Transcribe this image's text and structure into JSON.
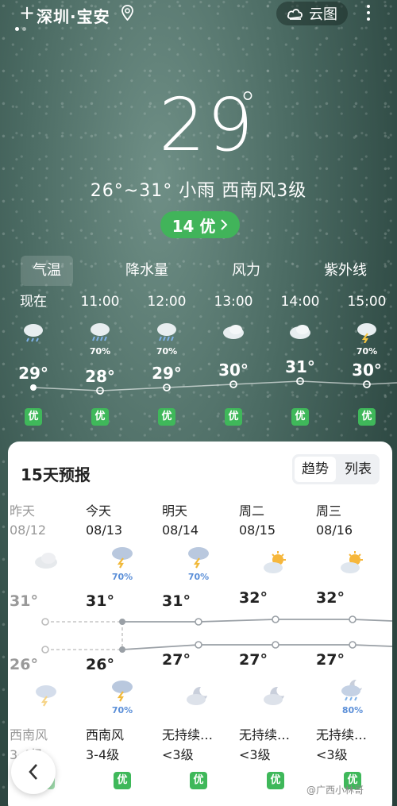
{
  "header": {
    "city": "深圳·宝安",
    "cloud_button": "云图"
  },
  "current": {
    "temp": "29",
    "summary": "26°~31° 小雨 西南风3级",
    "aqi": "14 优"
  },
  "tabs": [
    "气温",
    "降水量",
    "风力",
    "紫外线"
  ],
  "hourly": [
    {
      "time": "现在",
      "pct": "",
      "temp": "29°",
      "aqi": "优",
      "icon": "rain-cloud-icon"
    },
    {
      "time": "11:00",
      "pct": "70%",
      "temp": "28°",
      "aqi": "优",
      "icon": "heavy-rain-icon"
    },
    {
      "time": "12:00",
      "pct": "70%",
      "temp": "29°",
      "aqi": "优",
      "icon": "heavy-rain-icon"
    },
    {
      "time": "13:00",
      "pct": "",
      "temp": "30°",
      "aqi": "优",
      "icon": "cloudy-icon"
    },
    {
      "time": "14:00",
      "pct": "",
      "temp": "31°",
      "aqi": "优",
      "icon": "cloudy-icon"
    },
    {
      "time": "15:00",
      "pct": "70%",
      "temp": "30°",
      "aqi": "优",
      "icon": "thunderstorm-icon"
    }
  ],
  "forecast": {
    "title": "15天预报",
    "toggle": {
      "trend": "趋势",
      "list": "列表"
    },
    "days": [
      {
        "name": "昨天",
        "date": "08/12",
        "day_pct": "",
        "high": "31°",
        "low": "26°",
        "night_pct": "",
        "wind": "西南风",
        "level": "3-4级",
        "aqi": "优",
        "day_icon": "cloudy-icon",
        "night_icon": "thunderstorm-icon"
      },
      {
        "name": "今天",
        "date": "08/13",
        "day_pct": "70%",
        "high": "31°",
        "low": "26°",
        "night_pct": "70%",
        "wind": "西南风",
        "level": "3-4级",
        "aqi": "优",
        "day_icon": "thunderstorm-icon",
        "night_icon": "thunderstorm-icon"
      },
      {
        "name": "明天",
        "date": "08/14",
        "day_pct": "70%",
        "high": "31°",
        "low": "27°",
        "night_pct": "",
        "wind": "无持续…",
        "level": "<3级",
        "aqi": "优",
        "day_icon": "thunderstorm-icon",
        "night_icon": "moon-cloud-icon"
      },
      {
        "name": "周二",
        "date": "08/15",
        "day_pct": "",
        "high": "32°",
        "low": "27°",
        "night_pct": "",
        "wind": "无持续…",
        "level": "<3级",
        "aqi": "优",
        "day_icon": "sun-cloud-icon",
        "night_icon": "moon-cloud-icon"
      },
      {
        "name": "周三",
        "date": "08/16",
        "day_pct": "",
        "high": "32°",
        "low": "27°",
        "night_pct": "80%",
        "wind": "无持续…",
        "level": "<3级",
        "aqi": "优",
        "day_icon": "sun-cloud-icon",
        "night_icon": "night-rain-icon"
      }
    ]
  },
  "watermark": "@广西小林哥"
}
